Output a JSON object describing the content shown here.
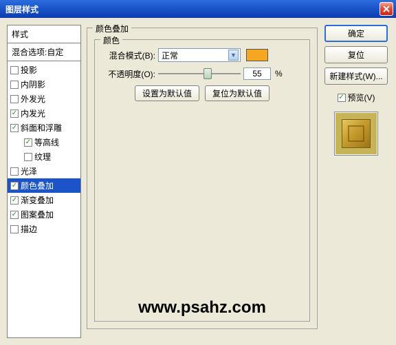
{
  "title": "图层样式",
  "sidebar": {
    "header": "样式",
    "blend_option": "混合选项:自定",
    "items": [
      {
        "label": "投影",
        "checked": false
      },
      {
        "label": "内阴影",
        "checked": false
      },
      {
        "label": "外发光",
        "checked": false
      },
      {
        "label": "内发光",
        "checked": true
      },
      {
        "label": "斜面和浮雕",
        "checked": true
      },
      {
        "label": "等高线",
        "checked": true,
        "indent": true
      },
      {
        "label": "纹理",
        "checked": false,
        "indent": true
      },
      {
        "label": "光泽",
        "checked": false
      },
      {
        "label": "颜色叠加",
        "checked": true,
        "active": true
      },
      {
        "label": "渐变叠加",
        "checked": true
      },
      {
        "label": "图案叠加",
        "checked": true
      },
      {
        "label": "描边",
        "checked": false
      }
    ]
  },
  "panel": {
    "group_title": "颜色叠加",
    "subgroup_title": "颜色",
    "blend_mode_label": "混合模式(B):",
    "blend_mode_value": "正常",
    "opacity_label": "不透明度(O):",
    "opacity_value": "55",
    "opacity_unit": "%",
    "set_default": "设置为默认值",
    "reset_default": "复位为默认值",
    "swatch_color": "#f5a623"
  },
  "buttons": {
    "ok": "确定",
    "cancel": "复位",
    "new_style": "新建样式(W)...",
    "preview": "预览(V)"
  },
  "watermark": "www.psahz.com"
}
